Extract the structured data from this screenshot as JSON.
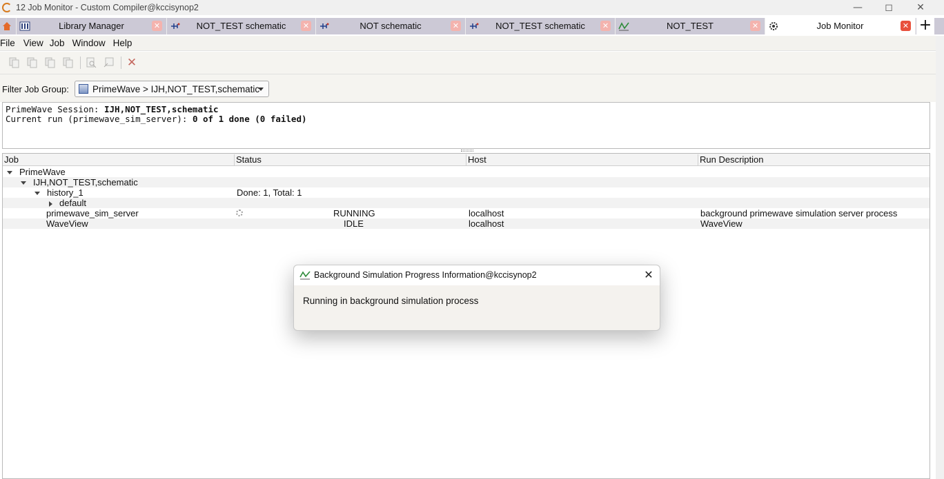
{
  "window": {
    "title": "12 Job Monitor - Custom Compiler@kccisynop2",
    "controls": [
      "minimize-icon",
      "maximize-icon",
      "close-icon"
    ]
  },
  "tabs": [
    {
      "label": "",
      "icon": "home-icon"
    },
    {
      "label": "Library Manager",
      "icon": "library-icon"
    },
    {
      "label": "NOT_TEST schematic",
      "icon": "schematic-icon"
    },
    {
      "label": "NOT schematic",
      "icon": "schematic-icon"
    },
    {
      "label": "NOT_TEST schematic",
      "icon": "schematic-icon"
    },
    {
      "label": "NOT_TEST",
      "icon": "waveform-icon"
    },
    {
      "label": "Job Monitor",
      "icon": "gear-icon",
      "active": true
    }
  ],
  "add_tab_label": "+",
  "menu": [
    "File",
    "View",
    "Job",
    "Window",
    "Help"
  ],
  "filter": {
    "label": "Filter Job Group:",
    "value": "PrimeWave > IJH,NOT_TEST,schematic"
  },
  "session": {
    "line1_label": "PrimeWave Session: ",
    "line1_value": "IJH,NOT_TEST,schematic",
    "line2_label": "Current run (primewave_sim_server): ",
    "line2_value": "0 of 1 done (0 failed)"
  },
  "table": {
    "columns": [
      "Job",
      "Status",
      "Host",
      "Run Description"
    ],
    "rows": [
      {
        "job": "PrimeWave",
        "status": "",
        "host": "",
        "desc": ""
      },
      {
        "job": "IJH,NOT_TEST,schematic",
        "status": "",
        "host": "",
        "desc": ""
      },
      {
        "job": "history_1",
        "status": "Done: 1, Total: 1",
        "host": "",
        "desc": ""
      },
      {
        "job": "default",
        "status": "",
        "host": "",
        "desc": ""
      },
      {
        "job": "primewave_sim_server",
        "status": "RUNNING",
        "host": "localhost",
        "desc": "background primewave simulation server process"
      },
      {
        "job": "WaveView",
        "status": "IDLE",
        "host": "localhost",
        "desc": "WaveView"
      }
    ]
  },
  "dialog": {
    "title": "Background Simulation Progress Information@kccisynop2",
    "message": "Running in background simulation process"
  },
  "colors": {
    "tabbar": "#ccc9d6",
    "close_active": "#e8503c",
    "close_inactive": "#f4b3ae"
  }
}
